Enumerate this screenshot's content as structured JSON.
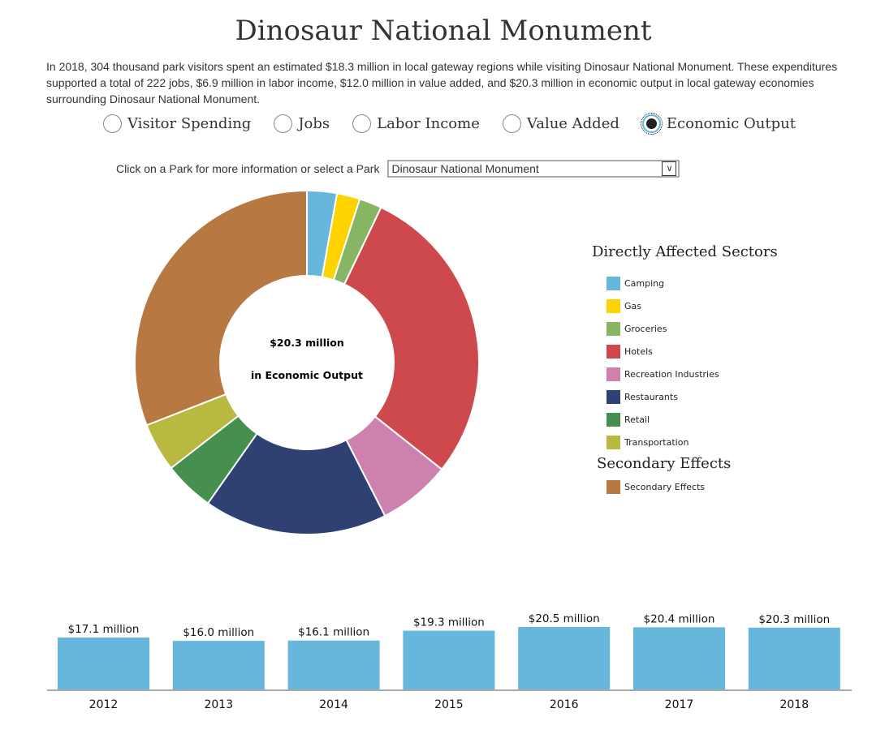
{
  "page": {
    "title": "Dinosaur National Monument",
    "summary": "In 2018, 304 thousand park visitors spent an estimated $18.3 million in local gateway regions while visiting Dinosaur National Monument. These expenditures supported a total of 222 jobs, $6.9 million in labor income, $12.0 million in value added, and $20.3 million in economic output in local gateway economies surrounding Dinosaur National Monument."
  },
  "metric_options": [
    {
      "label": "Visitor Spending",
      "checked": false
    },
    {
      "label": "Jobs",
      "checked": false
    },
    {
      "label": "Labor Income",
      "checked": false
    },
    {
      "label": "Value Added",
      "checked": false
    },
    {
      "label": "Economic Output",
      "checked": true
    }
  ],
  "park_select": {
    "prompt": "Click on a Park for more information or select a Park",
    "selected": "Dinosaur National Monument",
    "arrow_icon": "chevron-down-icon"
  },
  "chart_data": [
    {
      "type": "pie",
      "variant": "donut",
      "center_label_line1": "$20.3 million",
      "center_label_line2": "in Economic Output",
      "units": "$ million (estimated from slice angles)",
      "total": 20.3,
      "slices": [
        {
          "name": "Camping",
          "value": 0.57,
          "color": "#67b6dc",
          "group": "Directly Affected Sectors"
        },
        {
          "name": "Gas",
          "value": 0.44,
          "color": "#fed300",
          "group": "Directly Affected Sectors"
        },
        {
          "name": "Groceries",
          "value": 0.43,
          "color": "#86b663",
          "group": "Directly Affected Sectors"
        },
        {
          "name": "Hotels",
          "value": 5.8,
          "color": "#cd494b",
          "group": "Directly Affected Sectors"
        },
        {
          "name": "Recreation Industries",
          "value": 1.39,
          "color": "#cd81ae",
          "group": "Directly Affected Sectors"
        },
        {
          "name": "Restaurants",
          "value": 3.5,
          "color": "#2f4073",
          "group": "Directly Affected Sectors"
        },
        {
          "name": "Retail",
          "value": 0.96,
          "color": "#458f4f",
          "group": "Directly Affected Sectors"
        },
        {
          "name": "Transportation",
          "value": 0.93,
          "color": "#b9b840",
          "group": "Directly Affected Sectors"
        },
        {
          "name": "Secondary Effects",
          "value": 6.28,
          "color": "#b87841",
          "group": "Secondary Effects"
        }
      ],
      "legend": {
        "placement": "right",
        "groups": [
          {
            "title": "Directly Affected Sectors",
            "items": [
              "Camping",
              "Gas",
              "Groceries",
              "Hotels",
              "Recreation Industries",
              "Restaurants",
              "Retail",
              "Transportation"
            ]
          },
          {
            "title": "Secondary Effects",
            "items": [
              "Secondary Effects"
            ]
          }
        ]
      }
    },
    {
      "type": "bar",
      "title": "",
      "xlabel": "",
      "ylabel": "",
      "categories": [
        "2012",
        "2013",
        "2014",
        "2015",
        "2016",
        "2017",
        "2018"
      ],
      "values": [
        17.1,
        16.0,
        16.1,
        19.3,
        20.5,
        20.4,
        20.3
      ],
      "data_labels": [
        "$17.1 million",
        "$16.0 million",
        "$16.1 million",
        "$19.3 million",
        "$20.5 million",
        "$20.4 million",
        "$20.3 million"
      ],
      "bar_color": "#67b6dc",
      "grid": false
    }
  ]
}
